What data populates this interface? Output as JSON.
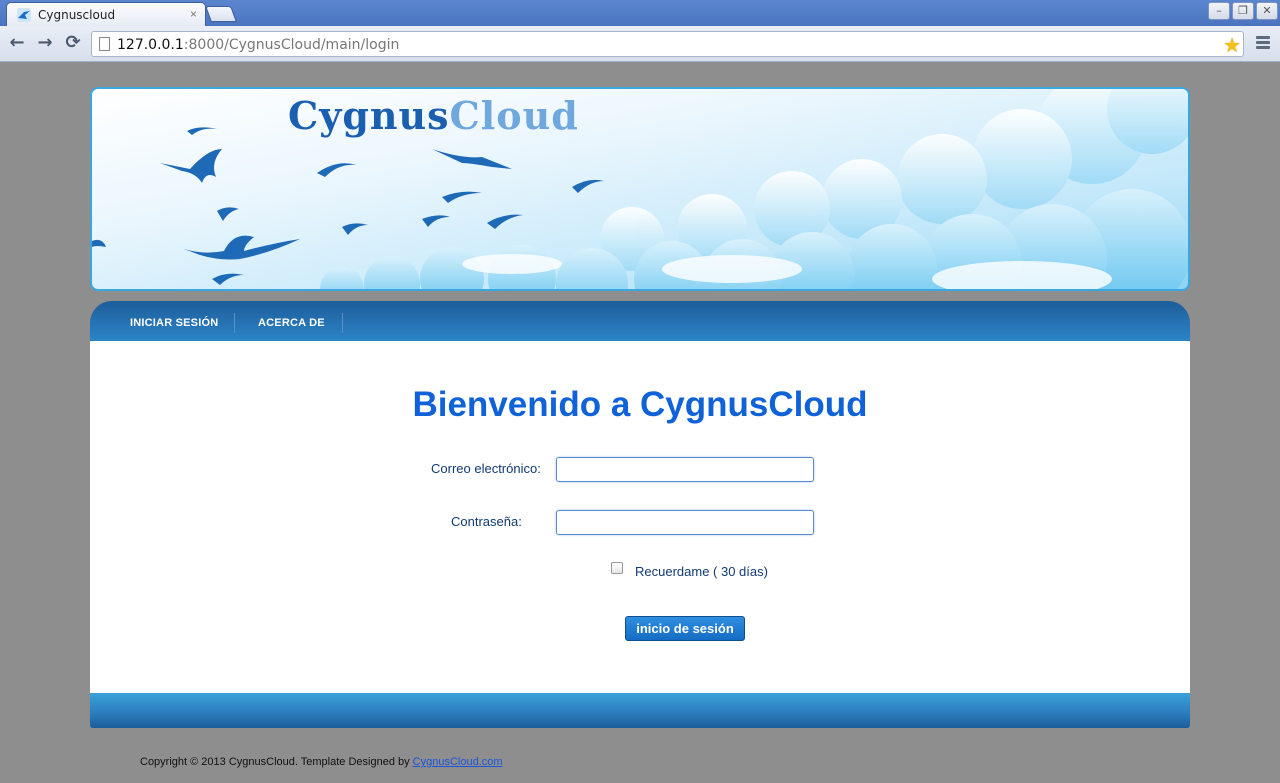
{
  "browser": {
    "tab_title": "Cygnuscloud",
    "tab_close": "×",
    "url_host": "127.0.0.1",
    "url_rest": ":8000/CygnusCloud/main/login",
    "back_icon": "←",
    "forward_icon": "→",
    "reload_icon": "⟳",
    "star_icon": "☆",
    "window": {
      "minimize": "–",
      "restore": "❐",
      "close": "✕"
    }
  },
  "banner": {
    "logo_cygnus": "Cygnus",
    "logo_cloud": "Cloud"
  },
  "nav": {
    "items": [
      {
        "label": "INICIAR SESIÓN"
      },
      {
        "label": "ACERCA DE"
      }
    ]
  },
  "main": {
    "title": "Bienvenido a CygnusCloud",
    "email_label": "Correo electrónico:",
    "email_value": "",
    "password_label": "Contraseña:",
    "password_value": "",
    "remember_label": "Recuerdame ( 30 días)",
    "remember_checked": false,
    "submit_label": "inicio de sesión"
  },
  "footer": {
    "copyright_text": "Copyright © 2013 CygnusCloud. Template Designed by ",
    "link_text": "CygnusCloud.com"
  },
  "colors": {
    "accent": "#0f62d8",
    "navbar": "#2774b5",
    "page_bg": "#8e8e8e"
  }
}
